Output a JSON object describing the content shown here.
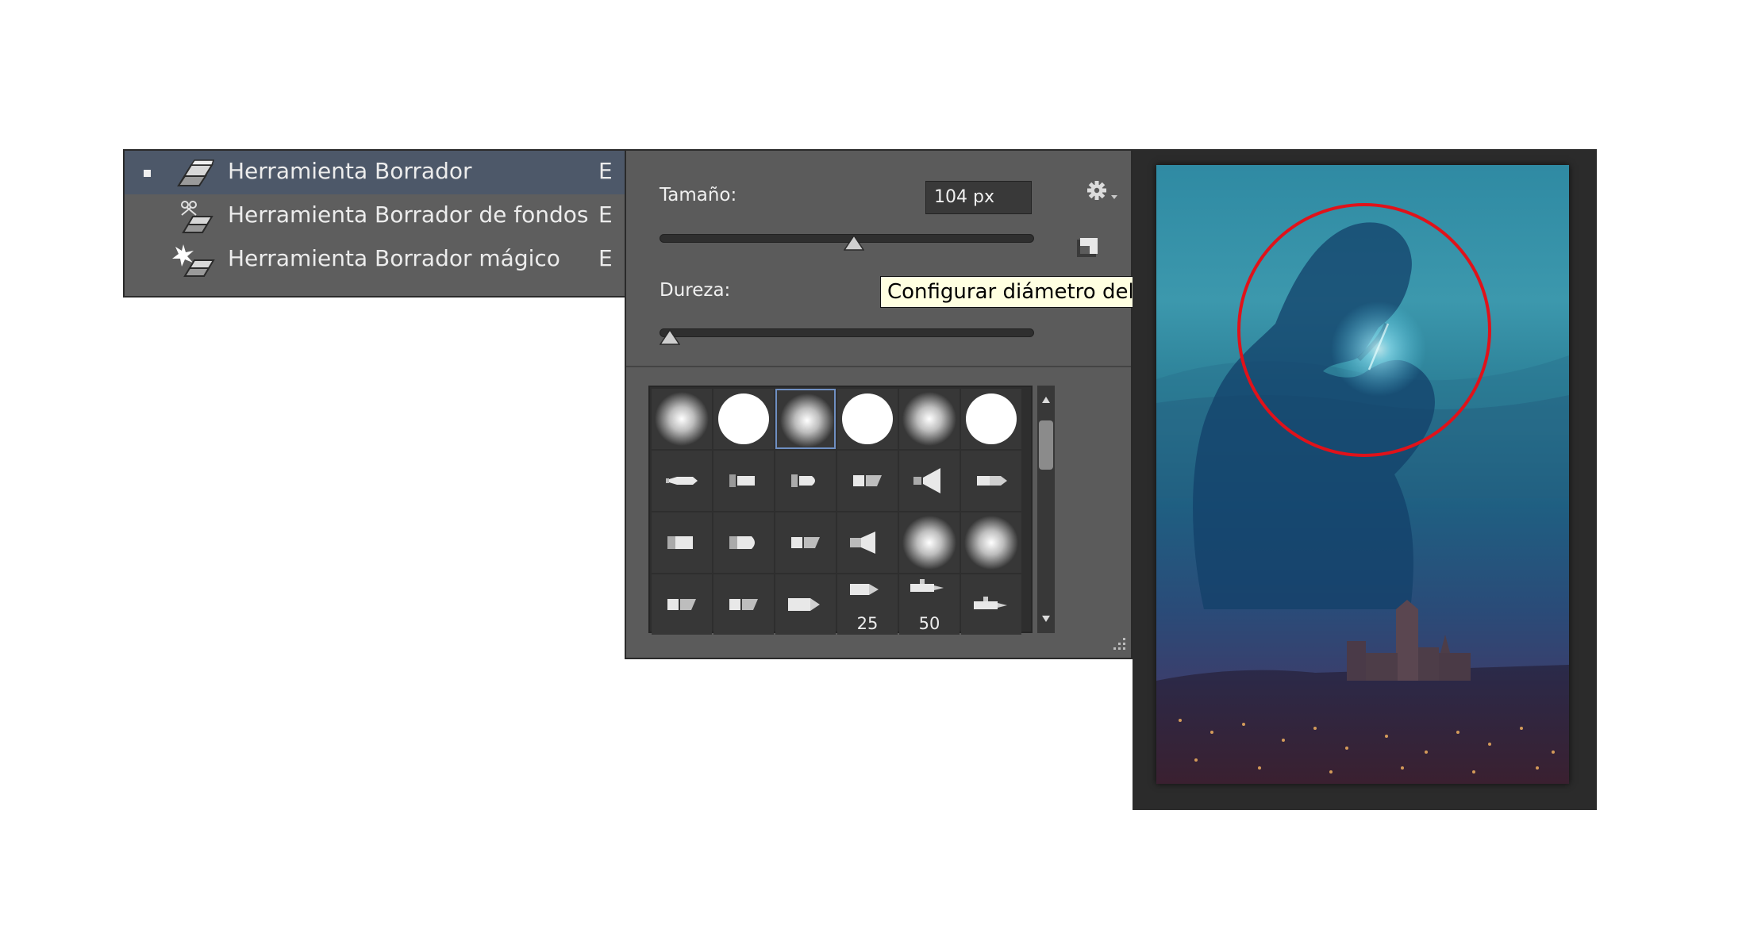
{
  "tool_menu": {
    "items": [
      {
        "label": "Herramienta Borrador",
        "shortcut": "E",
        "icon": "eraser-icon",
        "selected": true
      },
      {
        "label": "Herramienta Borrador de fondos",
        "shortcut": "E",
        "icon": "background-eraser-icon",
        "selected": false
      },
      {
        "label": "Herramienta Borrador mágico",
        "shortcut": "E",
        "icon": "magic-eraser-icon",
        "selected": false
      }
    ]
  },
  "brush_panel": {
    "size_label": "Tamaño:",
    "size_value": "104 px",
    "size_slider": 0.52,
    "hardness_label": "Dureza:",
    "hardness_slider": 0.0,
    "tooltip": "Configurar diámetro del",
    "icons": {
      "settings": "gear-icon",
      "reset": "reset-brush-icon"
    },
    "presets": [
      {
        "type": "soft"
      },
      {
        "type": "hard"
      },
      {
        "type": "soft",
        "active": true
      },
      {
        "type": "hard"
      },
      {
        "type": "soft"
      },
      {
        "type": "hard"
      },
      {
        "type": "tip-a"
      },
      {
        "type": "tip-b"
      },
      {
        "type": "tip-c"
      },
      {
        "type": "tip-d"
      },
      {
        "type": "tip-e"
      },
      {
        "type": "tip-f"
      },
      {
        "type": "tip-g"
      },
      {
        "type": "tip-h"
      },
      {
        "type": "tip-d"
      },
      {
        "type": "tip-i"
      },
      {
        "type": "soft"
      },
      {
        "type": "soft"
      },
      {
        "type": "tip-d"
      },
      {
        "type": "tip-d"
      },
      {
        "type": "tip-j"
      },
      {
        "type": "tip-k",
        "label": "25"
      },
      {
        "type": "tip-l",
        "label": "50"
      },
      {
        "type": "tip-m"
      }
    ]
  },
  "colors": {
    "panel_bg": "#5b5b5b",
    "selection": "#4d5869",
    "active_brush": "#6f8fc2",
    "brush_cursor": "#e0121a",
    "tooltip_bg": "#ffffe1"
  }
}
